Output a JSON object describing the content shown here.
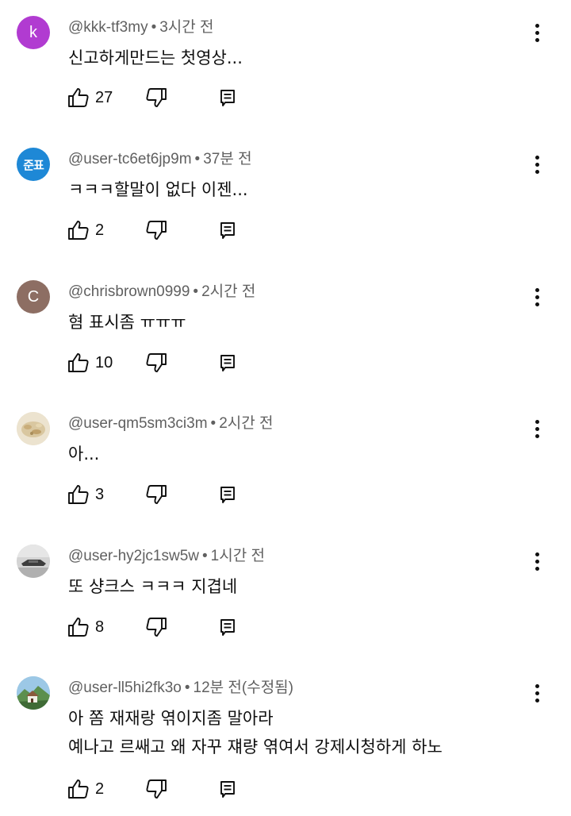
{
  "comments": [
    {
      "author": "@kkk-tf3my",
      "time": "3시간 전",
      "lines": [
        "신고하게만드는  첫영상..."
      ],
      "likes": "27",
      "avatar": {
        "type": "letter",
        "letter": "k",
        "color": "#b13bd1"
      }
    },
    {
      "author": "@user-tc6et6jp9m",
      "time": "37분 전",
      "lines": [
        "ㅋㅋㅋ할말이 없다 이젠..."
      ],
      "likes": "2",
      "avatar": {
        "type": "letter",
        "letter": "준표",
        "color": "#1e88d6"
      }
    },
    {
      "author": "@chrisbrown0999",
      "time": "2시간 전",
      "lines": [
        "혐 표시좀 ㅠㅠㅠ"
      ],
      "likes": "10",
      "avatar": {
        "type": "letter",
        "letter": "C",
        "color": "#8d6e63"
      }
    },
    {
      "author": "@user-qm5sm3ci3m",
      "time": "2시간 전",
      "lines": [
        "아..."
      ],
      "likes": "3",
      "avatar": {
        "type": "image",
        "letter": "",
        "color": "#e8dcc0"
      }
    },
    {
      "author": "@user-hy2jc1sw5w",
      "time": "1시간 전",
      "lines": [
        "또 샹크스 ㅋㅋㅋ 지겹네"
      ],
      "likes": "8",
      "avatar": {
        "type": "image",
        "letter": "",
        "color": "#c9c9c9"
      }
    },
    {
      "author": "@user-ll5hi2fk3o",
      "time": "12분 전(수정됨)",
      "lines": [
        "아 쫌 재재랑 엮이지좀 말아라",
        "예나고 르쌔고 왜 자꾸 쟤량 엮여서 강제시청하게 하노"
      ],
      "likes": "2",
      "avatar": {
        "type": "image",
        "letter": "",
        "color": "#7fb3d5"
      }
    }
  ],
  "icons": {
    "like": "thumb-up-icon",
    "dislike": "thumb-down-icon",
    "reply": "reply-icon",
    "more": "more-vert-icon"
  },
  "dot": "•"
}
